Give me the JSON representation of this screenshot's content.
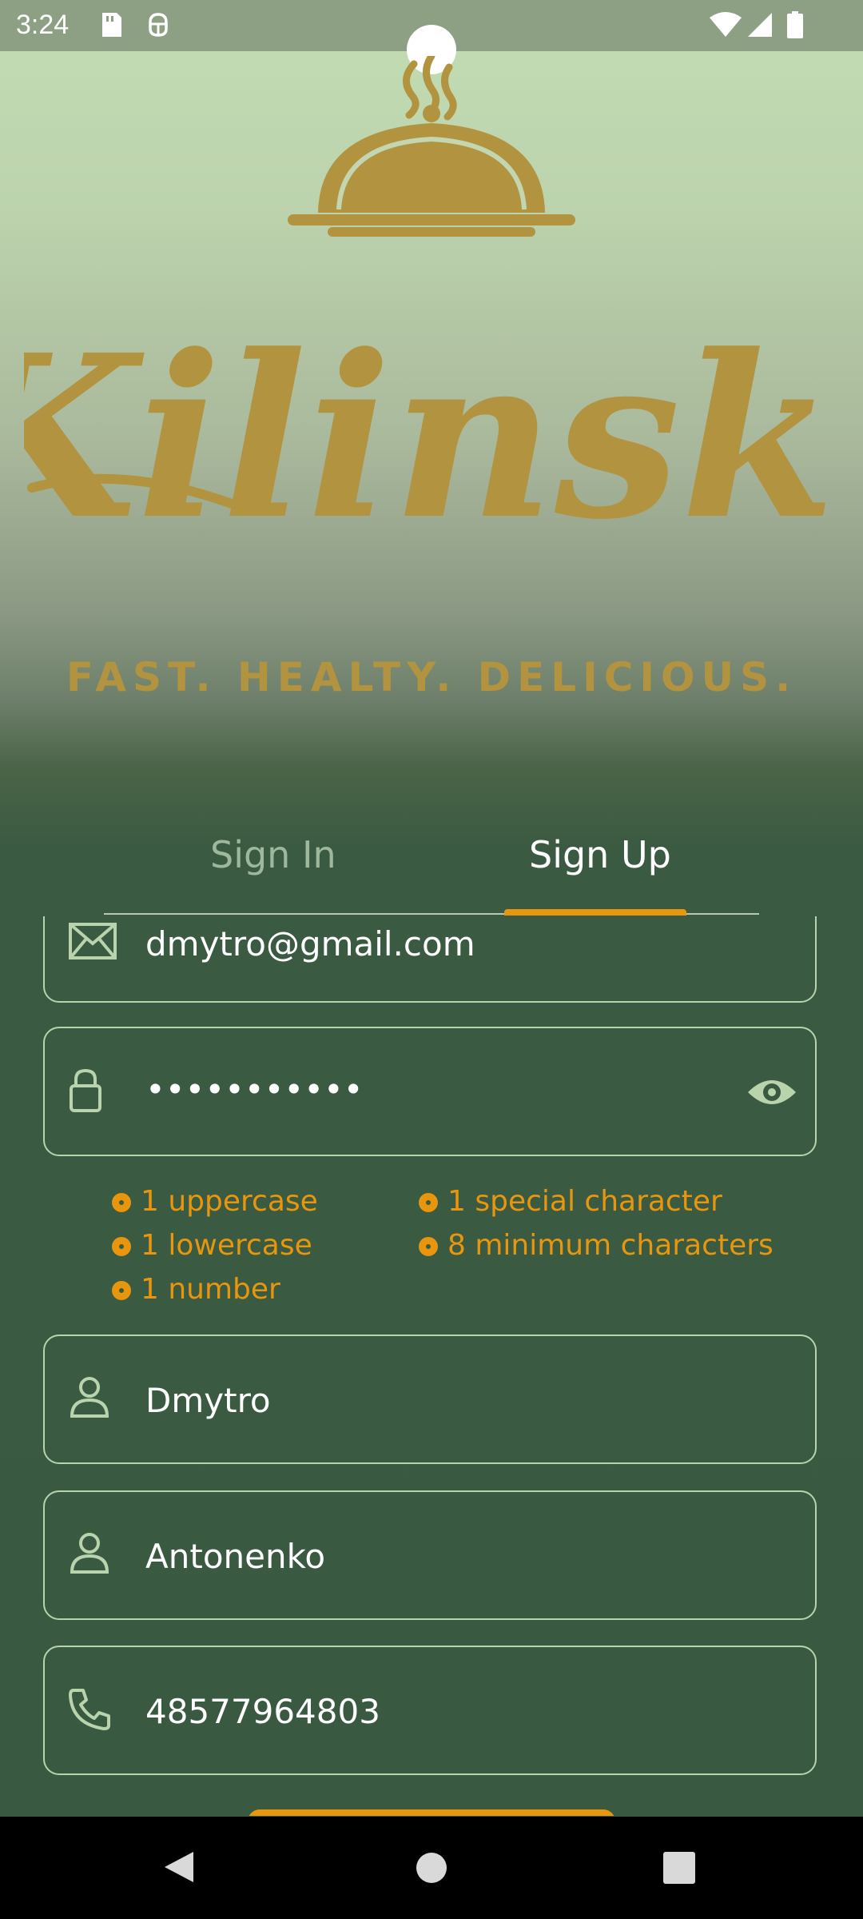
{
  "status_bar": {
    "time": "3:24",
    "icons": [
      "sd-card-icon",
      "android-debug-icon",
      "wifi-icon",
      "signal-icon",
      "battery-icon"
    ]
  },
  "brand": {
    "wordmark": "Kilinski",
    "tagline": "FAST. HEALTY. DELICIOUS.",
    "color": "#b2933f"
  },
  "tabs": [
    {
      "label": "Sign In",
      "selected": false
    },
    {
      "label": "Sign Up",
      "selected": true
    }
  ],
  "form": {
    "email": {
      "value": "dmytro@gmail.com",
      "icon": "mail-icon"
    },
    "password": {
      "value": "•••••••••••",
      "icon": "lock-icon",
      "toggle_icon": "eye-icon"
    },
    "requirements": [
      "1 uppercase",
      "1 lowercase",
      "1 number",
      "1 special character",
      "8 minimum characters"
    ],
    "first_name": {
      "value": "Dmytro",
      "icon": "person-icon"
    },
    "last_name": {
      "value": "Antonenko",
      "icon": "person-icon"
    },
    "phone": {
      "value": "48577964803",
      "icon": "phone-icon"
    }
  },
  "colors": {
    "accent": "#e8960e",
    "field_border": "#b9d4ad",
    "background": "#395941"
  },
  "nav_bar": [
    "back-icon",
    "home-icon",
    "recents-icon"
  ]
}
